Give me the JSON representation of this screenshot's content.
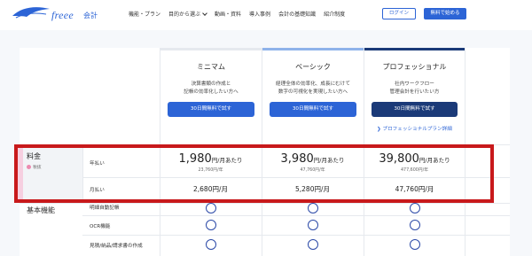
{
  "header": {
    "logo": "freee",
    "logo_sub": "会計",
    "nav": [
      {
        "label": "機能・プラン"
      },
      {
        "label": "目的から選ぶ"
      },
      {
        "label": "動画・資料"
      },
      {
        "label": "導入事例"
      },
      {
        "label": "会計の基礎知識"
      },
      {
        "label": "紹介制度"
      }
    ],
    "login_label": "ログイン",
    "start_label": "無料で始める"
  },
  "plans": [
    {
      "name": "ミニマム",
      "desc_line1": "決算書類の作成と",
      "desc_line2": "記帳の効率化したい方へ",
      "button": "30日間無料で試す",
      "bar_color": "#ffffff",
      "annual_price": "1,980",
      "annual_unit": "円/月あたり",
      "annual_sub": "23,760円/年",
      "monthly": "2,680円/月"
    },
    {
      "name": "ベーシック",
      "desc_line1": "経理全体の効率化、成長にむけて",
      "desc_line2": "数字の可視化を実現したい方へ",
      "button": "30日間無料で試す",
      "bar_color": "#8fb3ea",
      "annual_price": "3,980",
      "annual_unit": "円/月あたり",
      "annual_sub": "47,760円/年",
      "monthly": "5,280円/月"
    },
    {
      "name": "プロフェッショナル",
      "desc_line1": "社内ワークフロー",
      "desc_line2": "管理会計を行いたい方",
      "button": "30日間無料で試す",
      "bar_color": "#1b3a78",
      "link": "プロフェッショナルプラン詳細",
      "annual_price": "39,800",
      "annual_unit": "円/月あたり",
      "annual_sub": "477,600円/年",
      "monthly": "47,760円/月"
    }
  ],
  "pricing": {
    "group_title": "料金",
    "tax_note": "税抜",
    "annual_label": "年払い",
    "monthly_label": "月払い"
  },
  "features": {
    "section_title": "基本機能",
    "items": [
      {
        "label": "明細自動記帳"
      },
      {
        "label": "OCR機能"
      },
      {
        "label": "見積/納品/請求書の作成"
      }
    ]
  },
  "colors": {
    "accent": "#2c64d6",
    "dark_accent": "#1b3a78",
    "highlight_red": "#c8191b"
  }
}
